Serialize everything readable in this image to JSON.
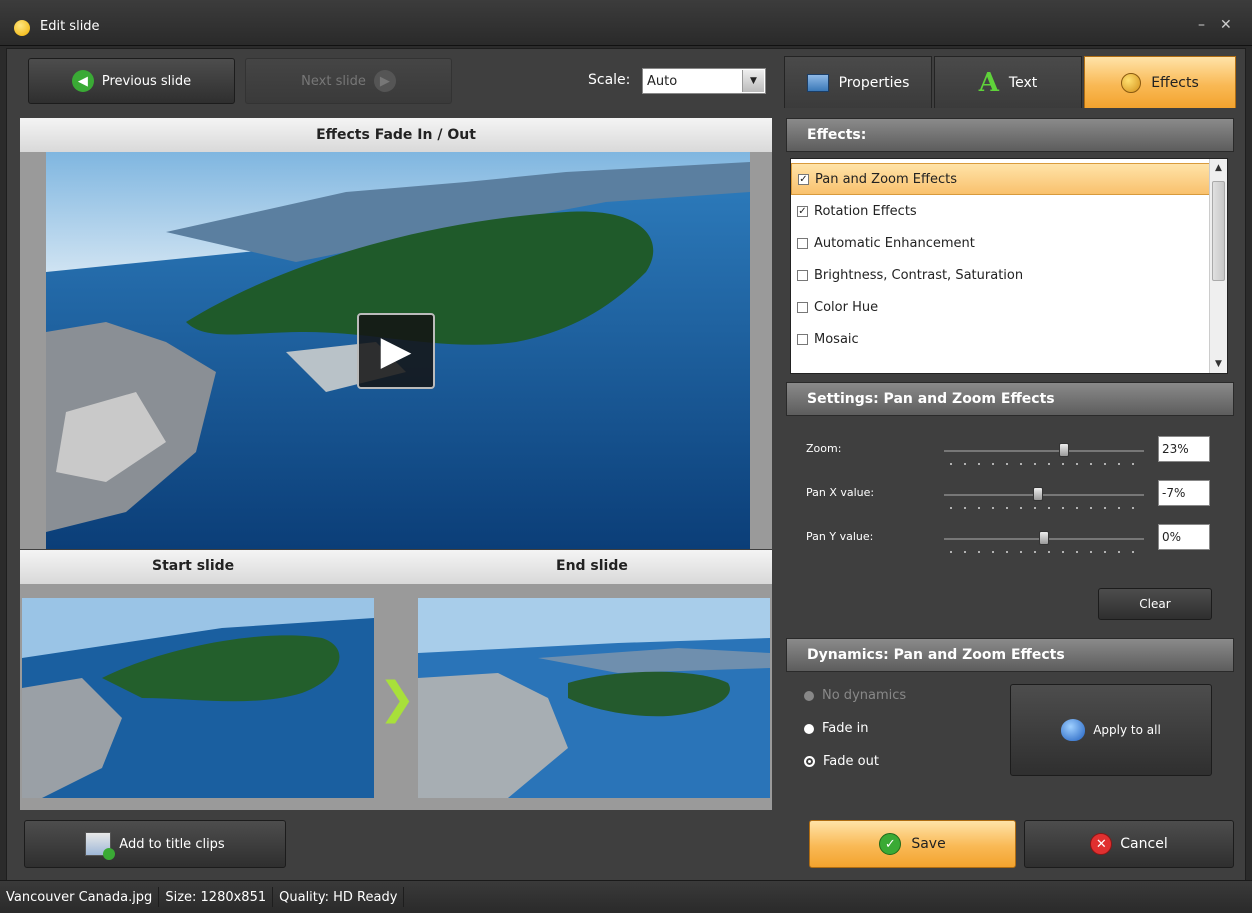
{
  "window": {
    "title": "Edit slide",
    "minimize_glyph": "–",
    "close_glyph": "✕"
  },
  "toolbar": {
    "previous_label": "Previous slide",
    "next_label": "Next slide",
    "scale_label": "Scale:",
    "scale_value": "Auto"
  },
  "preview": {
    "header": "Effects Fade In / Out",
    "start_label": "Start slide",
    "end_label": "End slide"
  },
  "tabs": [
    {
      "label": "Properties",
      "icon": "properties-icon"
    },
    {
      "label": "Text",
      "icon": "text-icon"
    },
    {
      "label": "Effects",
      "icon": "effects-icon"
    }
  ],
  "effects": {
    "header": "Effects:",
    "items": [
      {
        "label": "Pan and Zoom Effects",
        "checked": true,
        "selected": true
      },
      {
        "label": "Rotation Effects",
        "checked": true,
        "selected": false
      },
      {
        "label": "Automatic Enhancement",
        "checked": false,
        "selected": false
      },
      {
        "label": "Brightness, Contrast, Saturation",
        "checked": false,
        "selected": false
      },
      {
        "label": "Color Hue",
        "checked": false,
        "selected": false
      },
      {
        "label": "Mosaic",
        "checked": false,
        "selected": false
      }
    ]
  },
  "settings": {
    "header": "Settings: Pan and Zoom Effects",
    "zoom_label": "Zoom:",
    "zoom_value": "23%",
    "zoom_level": 0.6,
    "panx_label": "Pan X value:",
    "panx_value": "-7%",
    "panx_level": 0.47,
    "pany_label": "Pan Y value:",
    "pany_value": "0%",
    "pany_level": 0.5,
    "clear_label": "Clear"
  },
  "dynamics": {
    "header": "Dynamics: Pan and Zoom Effects",
    "options": [
      {
        "label": "No dynamics",
        "disabled": true,
        "checked": false
      },
      {
        "label": "Fade in",
        "disabled": false,
        "checked": false
      },
      {
        "label": "Fade out",
        "disabled": false,
        "checked": true
      }
    ],
    "apply_all_label": "Apply to all"
  },
  "footer": {
    "add_title_label": "Add to title clips",
    "save_label": "Save",
    "cancel_label": "Cancel"
  },
  "status": {
    "file": "Vancouver Canada.jpg",
    "size": "Size: 1280x851",
    "quality": "Quality: HD Ready"
  },
  "colors": {
    "accent": "#f9b955",
    "accent_dark": "#f3a32e",
    "bg": "#3f3f3f"
  }
}
